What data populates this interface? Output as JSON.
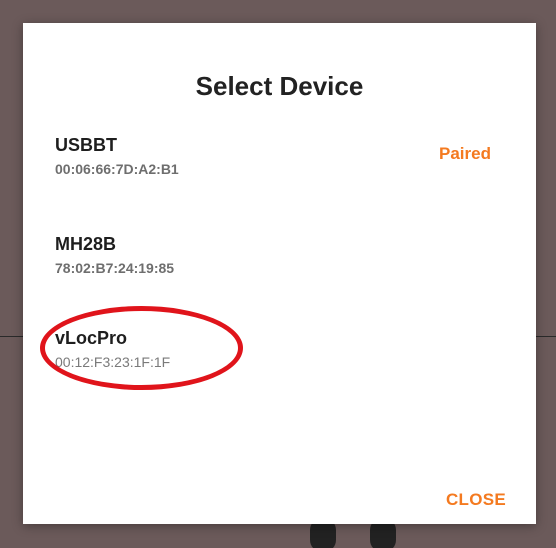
{
  "dialog": {
    "title": "Select Device",
    "devices": [
      {
        "name": "USBBT",
        "address": "00:06:66:7D:A2:B1",
        "status": "Paired"
      },
      {
        "name": "MH28B",
        "address": "78:02:B7:24:19:85",
        "status": ""
      },
      {
        "name": "vLocPro",
        "address": "00:12:F3:23:1F:1F",
        "status": ""
      }
    ],
    "close_label": "CLOSE"
  },
  "colors": {
    "accent": "#f47a20",
    "annotation": "#e0141b",
    "backdrop": "#6b5a5a"
  }
}
